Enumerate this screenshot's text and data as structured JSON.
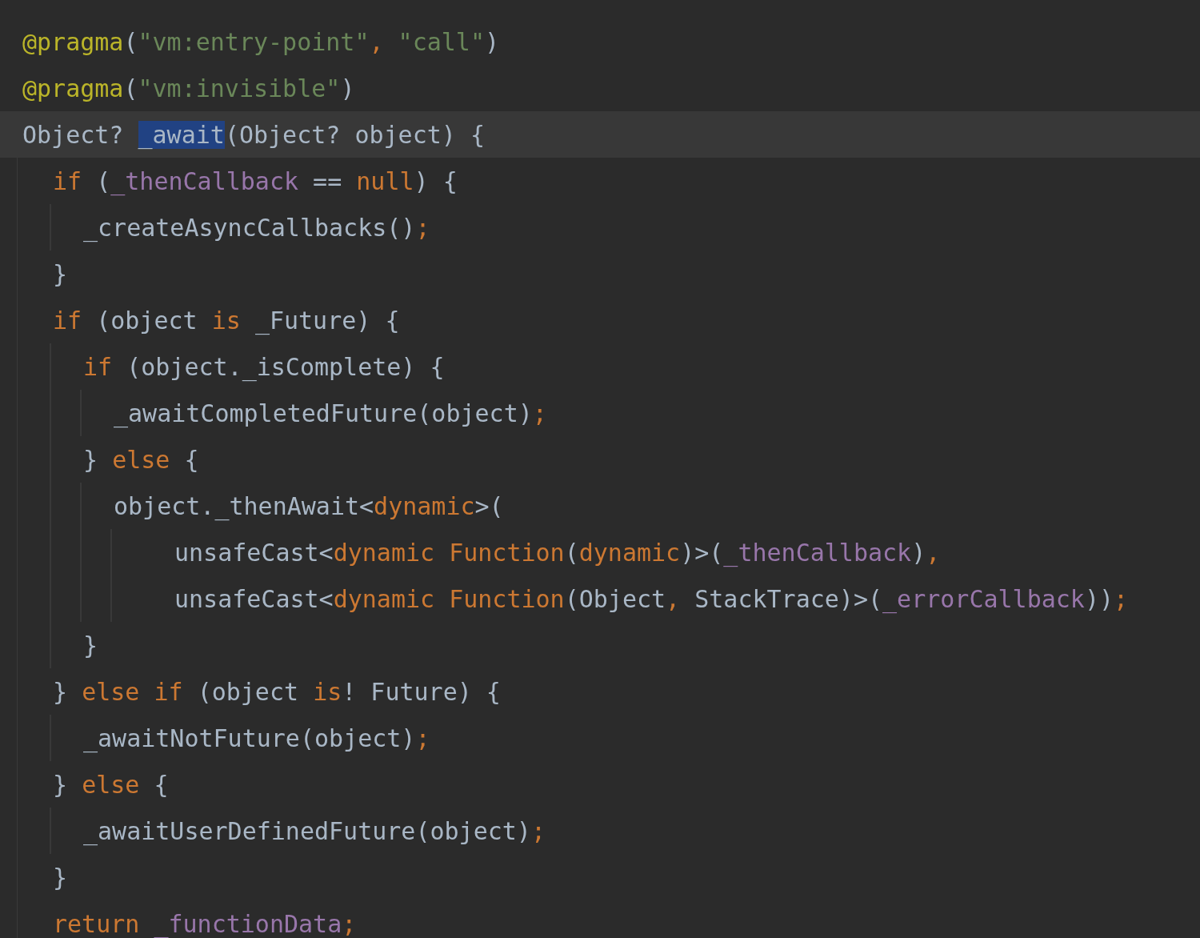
{
  "editor": {
    "lines": [
      {
        "kind": "statement",
        "current": false,
        "tokens": [
          {
            "kind": "annotation",
            "text": "@pragma"
          },
          {
            "kind": "plain",
            "text": "("
          },
          {
            "kind": "string",
            "text": "\"vm:entry-point\""
          },
          {
            "kind": "keyword",
            "text": ", "
          },
          {
            "kind": "string",
            "text": "\"call\""
          },
          {
            "kind": "plain",
            "text": ")"
          }
        ]
      },
      {
        "kind": "statement",
        "current": false,
        "tokens": [
          {
            "kind": "annotation",
            "text": "@pragma"
          },
          {
            "kind": "plain",
            "text": "("
          },
          {
            "kind": "string",
            "text": "\"vm:invisible\""
          },
          {
            "kind": "plain",
            "text": ")"
          }
        ]
      },
      {
        "kind": "statement",
        "current": true,
        "tokens": [
          {
            "kind": "plain",
            "text": "Object? "
          },
          {
            "kind": "selected",
            "text": "_await"
          },
          {
            "kind": "plain",
            "text": "(Object? object) {"
          }
        ],
        "children": [
          {
            "kind": "statement",
            "current": false,
            "tokens": [
              {
                "kind": "keyword",
                "text": "if "
              },
              {
                "kind": "plain",
                "text": "("
              },
              {
                "kind": "field",
                "text": "_thenCallback"
              },
              {
                "kind": "plain",
                "text": " == "
              },
              {
                "kind": "keyword",
                "text": "null"
              },
              {
                "kind": "plain",
                "text": ") {"
              }
            ],
            "children": [
              {
                "kind": "statement",
                "current": false,
                "tokens": [
                  {
                    "kind": "plain",
                    "text": "_createAsyncCallbacks()"
                  },
                  {
                    "kind": "keyword",
                    "text": ";"
                  }
                ]
              }
            ]
          },
          {
            "kind": "statement",
            "current": false,
            "tokens": [
              {
                "kind": "plain",
                "text": "}"
              }
            ]
          },
          {
            "kind": "statement",
            "current": false,
            "tokens": [
              {
                "kind": "keyword",
                "text": "if "
              },
              {
                "kind": "plain",
                "text": "(object "
              },
              {
                "kind": "keyword",
                "text": "is "
              },
              {
                "kind": "plain",
                "text": "_Future) {"
              }
            ],
            "children": [
              {
                "kind": "statement",
                "current": false,
                "tokens": [
                  {
                    "kind": "keyword",
                    "text": "if "
                  },
                  {
                    "kind": "plain",
                    "text": "(object._isComplete) {"
                  }
                ],
                "children": [
                  {
                    "kind": "statement",
                    "current": false,
                    "tokens": [
                      {
                        "kind": "plain",
                        "text": "_awaitCompletedFuture(object)"
                      },
                      {
                        "kind": "keyword",
                        "text": ";"
                      }
                    ]
                  }
                ]
              },
              {
                "kind": "statement",
                "current": false,
                "tokens": [
                  {
                    "kind": "plain",
                    "text": "} "
                  },
                  {
                    "kind": "keyword",
                    "text": "else "
                  },
                  {
                    "kind": "plain",
                    "text": "{"
                  }
                ],
                "children": [
                  {
                    "kind": "statement",
                    "current": false,
                    "tokens": [
                      {
                        "kind": "plain",
                        "text": "object._thenAwait<"
                      },
                      {
                        "kind": "keyword",
                        "text": "dynamic"
                      },
                      {
                        "kind": "plain",
                        "text": ">("
                      }
                    ],
                    "children": [
                      {
                        "kind": "continuation",
                        "current": false,
                        "tokens": [
                          {
                            "kind": "plain",
                            "text": "unsafeCast<"
                          },
                          {
                            "kind": "keyword",
                            "text": "dynamic Function"
                          },
                          {
                            "kind": "plain",
                            "text": "("
                          },
                          {
                            "kind": "keyword",
                            "text": "dynamic"
                          },
                          {
                            "kind": "plain",
                            "text": ")>("
                          },
                          {
                            "kind": "field",
                            "text": "_thenCallback"
                          },
                          {
                            "kind": "plain",
                            "text": ")"
                          },
                          {
                            "kind": "keyword",
                            "text": ","
                          }
                        ]
                      },
                      {
                        "kind": "continuation",
                        "current": false,
                        "tokens": [
                          {
                            "kind": "plain",
                            "text": "unsafeCast<"
                          },
                          {
                            "kind": "keyword",
                            "text": "dynamic Function"
                          },
                          {
                            "kind": "plain",
                            "text": "(Object"
                          },
                          {
                            "kind": "keyword",
                            "text": ", "
                          },
                          {
                            "kind": "plain",
                            "text": "StackTrace)>("
                          },
                          {
                            "kind": "field",
                            "text": "_errorCallback"
                          },
                          {
                            "kind": "plain",
                            "text": "))"
                          },
                          {
                            "kind": "keyword",
                            "text": ";"
                          }
                        ]
                      }
                    ]
                  }
                ]
              },
              {
                "kind": "statement",
                "current": false,
                "tokens": [
                  {
                    "kind": "plain",
                    "text": "}"
                  }
                ]
              }
            ]
          },
          {
            "kind": "statement",
            "current": false,
            "tokens": [
              {
                "kind": "plain",
                "text": "} "
              },
              {
                "kind": "keyword",
                "text": "else if "
              },
              {
                "kind": "plain",
                "text": "(object "
              },
              {
                "kind": "keyword",
                "text": "is"
              },
              {
                "kind": "plain",
                "text": "! Future) {"
              }
            ],
            "children": [
              {
                "kind": "statement",
                "current": false,
                "tokens": [
                  {
                    "kind": "plain",
                    "text": "_awaitNotFuture(object)"
                  },
                  {
                    "kind": "keyword",
                    "text": ";"
                  }
                ]
              }
            ]
          },
          {
            "kind": "statement",
            "current": false,
            "tokens": [
              {
                "kind": "plain",
                "text": "} "
              },
              {
                "kind": "keyword",
                "text": "else "
              },
              {
                "kind": "plain",
                "text": "{"
              }
            ],
            "children": [
              {
                "kind": "statement",
                "current": false,
                "tokens": [
                  {
                    "kind": "plain",
                    "text": "_awaitUserDefinedFuture(object)"
                  },
                  {
                    "kind": "keyword",
                    "text": ";"
                  }
                ]
              }
            ]
          },
          {
            "kind": "statement",
            "current": false,
            "tokens": [
              {
                "kind": "plain",
                "text": "}"
              }
            ]
          },
          {
            "kind": "statement",
            "current": false,
            "tokens": [
              {
                "kind": "keyword",
                "text": "return "
              },
              {
                "kind": "field",
                "text": "_functionData"
              },
              {
                "kind": "keyword",
                "text": ";"
              }
            ]
          }
        ]
      }
    ]
  }
}
